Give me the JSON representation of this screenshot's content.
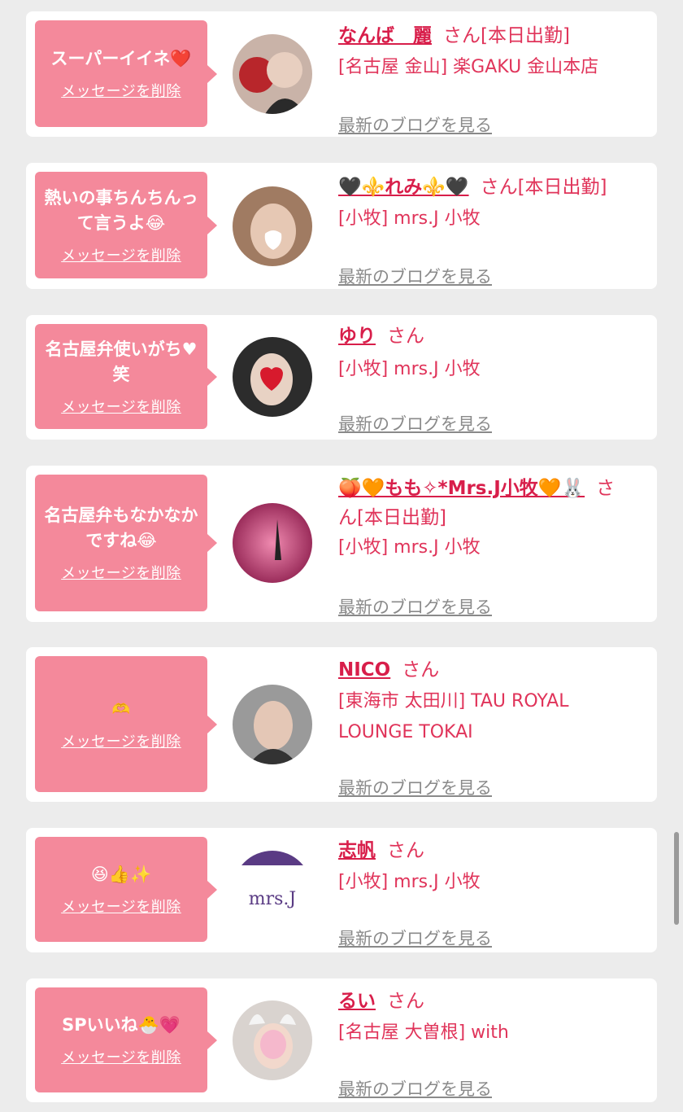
{
  "messages": [
    {
      "message": "スーパーイイネ❤️",
      "delete_label": "メッセージを削除",
      "name": "なんば　麗",
      "suffix": "さん",
      "status": "[本日出勤]",
      "shop": "[名古屋 金山] 楽GAKU 金山本店",
      "blog_label": "最新のブログを見る"
    },
    {
      "message": "熱いの事ちんちんって言うよ😂",
      "delete_label": "メッセージを削除",
      "name": "🖤⚜️れみ⚜️🖤",
      "suffix": "さん",
      "status": "[本日出勤]",
      "shop": "[小牧] mrs.J 小牧",
      "blog_label": "最新のブログを見る"
    },
    {
      "message": "名古屋弁使いがち♥笑",
      "delete_label": "メッセージを削除",
      "name": "ゆり",
      "suffix": "さん",
      "status": "",
      "shop": "[小牧] mrs.J 小牧",
      "blog_label": "最新のブログを見る"
    },
    {
      "message": "名古屋弁もなかなかですね😂",
      "delete_label": "メッセージを削除",
      "name": "🍑🧡もも✧*Mrs.J小牧🧡🐰",
      "suffix": "さ",
      "suffix2": "ん[本日出勤]",
      "status": "",
      "shop": "[小牧] mrs.J 小牧",
      "blog_label": "最新のブログを見る"
    },
    {
      "message": "🫶",
      "delete_label": "メッセージを削除",
      "name": "NICO",
      "suffix": "さん",
      "status": "",
      "shop": "[東海市 太田川] TAU ROYAL LOUNGE TOKAI",
      "blog_label": "最新のブログを見る"
    },
    {
      "message": "😆👍✨",
      "delete_label": "メッセージを削除",
      "name": "志帆",
      "suffix": "さん",
      "status": "",
      "shop": "[小牧] mrs.J 小牧",
      "blog_label": "最新のブログを見る",
      "logo_text": "mrs.J"
    },
    {
      "message": "SPいいね🐣💗",
      "delete_label": "メッセージを削除",
      "name": "るい",
      "suffix": "さん",
      "status": "",
      "shop": "[名古屋 大曽根] with",
      "blog_label": "最新のブログを見る"
    }
  ],
  "colors": {
    "accent": "#e0345a",
    "bubble": "#f4899b",
    "link_gray": "#8a8a8a",
    "background": "#ececec"
  }
}
